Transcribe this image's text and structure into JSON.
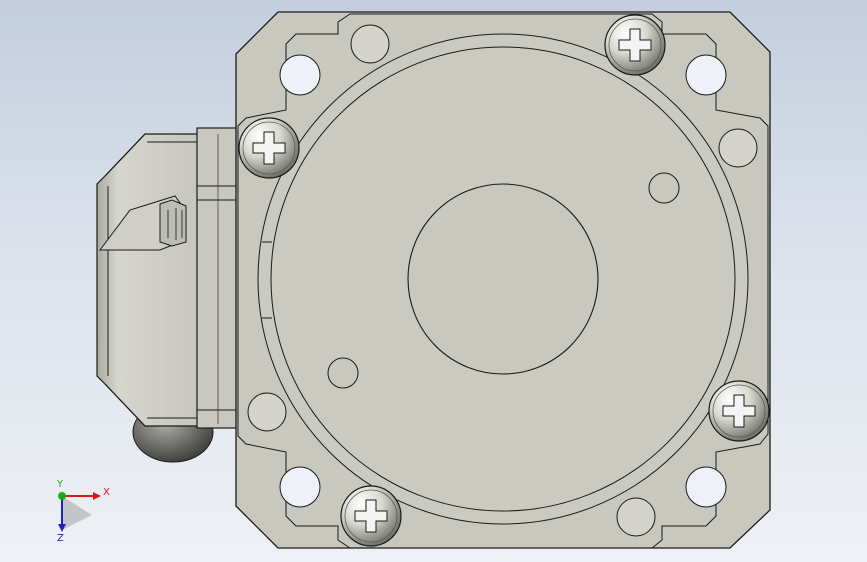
{
  "viewport": {
    "background_top": "#c3cede",
    "background_bottom": "#eef1f5"
  },
  "model": {
    "body_color": "#c8c8bf",
    "edge_color": "#1a1a1a",
    "screw_highlight": "#f4f4f4",
    "screw_shadow": "#5a5a55",
    "screw_count": 4,
    "screw_icon": "phillips-screw-icon"
  },
  "triad": {
    "x_label": "X",
    "y_label": "Y",
    "z_label": "Z",
    "x_color": "#d81818",
    "y_color": "#16b016",
    "z_color": "#2020c8"
  }
}
